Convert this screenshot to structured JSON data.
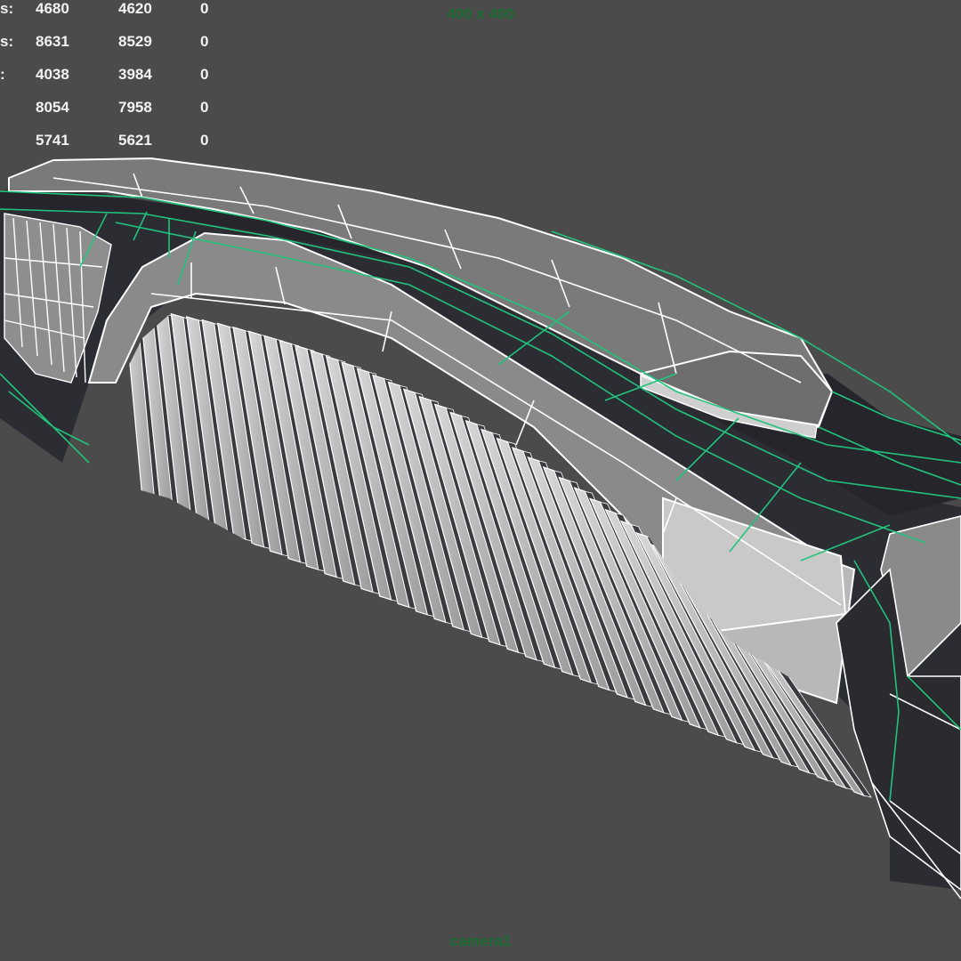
{
  "viewport": {
    "resolution_label": "400 x 400",
    "camera_label": "camera1",
    "background_color": "#4b4b4b",
    "hud_text_color": "#f2f2f2",
    "hud_label_color": "#1b6b33",
    "selection_wire_color": "#22c37d"
  },
  "hud_stats": {
    "rows": [
      {
        "label": "s:",
        "values": [
          "4680",
          "4620",
          "0"
        ]
      },
      {
        "label": "s:",
        "values": [
          "8631",
          "8529",
          "0"
        ]
      },
      {
        "label": ":",
        "values": [
          "4038",
          "3984",
          "0"
        ]
      },
      {
        "label": "",
        "values": [
          "8054",
          "7958",
          "0"
        ]
      },
      {
        "label": "",
        "values": [
          "5741",
          "5621",
          "0"
        ]
      }
    ]
  },
  "model": {
    "subject": "car-front-grille-wireframe"
  }
}
